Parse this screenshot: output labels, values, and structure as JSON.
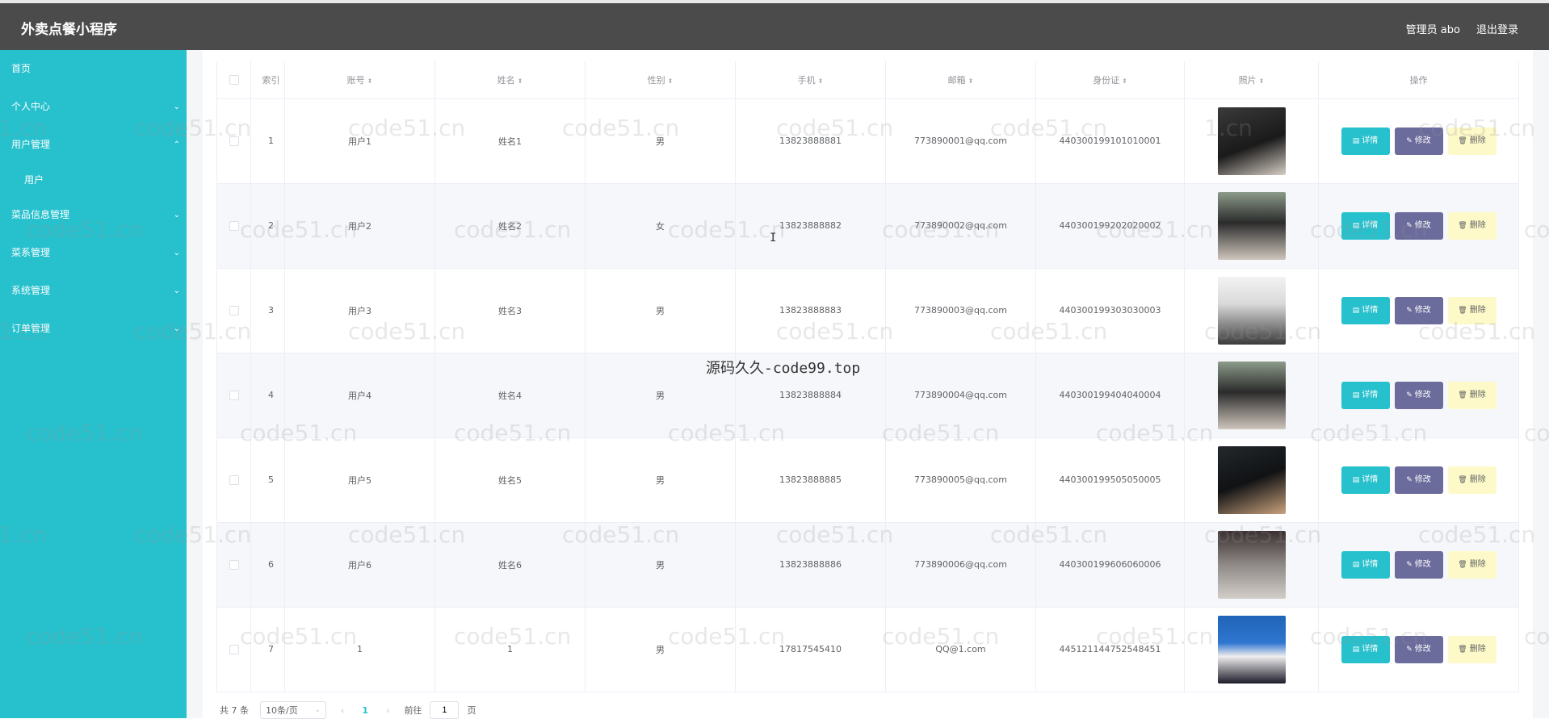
{
  "header": {
    "app_title": "外卖点餐小程序",
    "admin_label": "管理员 abo",
    "logout_label": "退出登录"
  },
  "sidebar": {
    "items": [
      {
        "label": "首页",
        "chev": ""
      },
      {
        "label": "个人中心",
        "chev": "⌄"
      },
      {
        "label": "用户管理",
        "chev": "⌃"
      },
      {
        "label": "用户",
        "chev": ""
      },
      {
        "label": "菜品信息管理",
        "chev": "⌄"
      },
      {
        "label": "菜系管理",
        "chev": "⌄"
      },
      {
        "label": "系统管理",
        "chev": "⌄"
      },
      {
        "label": "订单管理",
        "chev": "⌄"
      }
    ]
  },
  "table": {
    "columns": [
      "索引",
      "账号",
      "姓名",
      "性别",
      "手机",
      "邮箱",
      "身份证",
      "照片",
      "操作"
    ],
    "sort_icon": "⬍",
    "buttons": {
      "detail": "详情",
      "edit": "修改",
      "delete": "删除"
    },
    "rows": [
      {
        "index": "1",
        "account": "用户1",
        "name": "姓名1",
        "gender": "男",
        "phone": "13823888881",
        "email": "773890001@qq.com",
        "id_card": "440300199101010001",
        "photo": "portrait-photo"
      },
      {
        "index": "2",
        "account": "用户2",
        "name": "姓名2",
        "gender": "女",
        "phone": "13823888882",
        "email": "773890002@qq.com",
        "id_card": "440300199202020002",
        "photo": "portrait-photo"
      },
      {
        "index": "3",
        "account": "用户3",
        "name": "姓名3",
        "gender": "男",
        "phone": "13823888883",
        "email": "773890003@qq.com",
        "id_card": "440300199303030003",
        "photo": "portrait-photo"
      },
      {
        "index": "4",
        "account": "用户4",
        "name": "姓名4",
        "gender": "男",
        "phone": "13823888884",
        "email": "773890004@qq.com",
        "id_card": "440300199404040004",
        "photo": "portrait-photo"
      },
      {
        "index": "5",
        "account": "用户5",
        "name": "姓名5",
        "gender": "男",
        "phone": "13823888885",
        "email": "773890005@qq.com",
        "id_card": "440300199505050005",
        "photo": "portrait-photo"
      },
      {
        "index": "6",
        "account": "用户6",
        "name": "姓名6",
        "gender": "男",
        "phone": "13823888886",
        "email": "773890006@qq.com",
        "id_card": "440300199606060006",
        "photo": "portrait-photo"
      },
      {
        "index": "7",
        "account": "1",
        "name": "1",
        "gender": "男",
        "phone": "17817545410",
        "email": "QQ@1.com",
        "id_card": "445121144752548451",
        "photo": "portrait-photo"
      }
    ]
  },
  "pagination": {
    "total": "共 7 条",
    "page_size": "10条/页",
    "prev": "‹",
    "current_page": "1",
    "next": "›",
    "goto_label": "前往",
    "goto_value": "1",
    "page_suffix": "页"
  },
  "overlays": {
    "watermark_text": "code51.cn",
    "watermark_fragment": "1.cn",
    "center_watermark": "源码久久-code99.top",
    "cursor_glyph": "I"
  },
  "colors": {
    "header_bg": "#4b4b4b",
    "sidebar_bg": "#27c0cd",
    "detail_button": "#27c0cd",
    "edit_button": "#6b6b9c",
    "delete_button": "#fdf9c8"
  }
}
